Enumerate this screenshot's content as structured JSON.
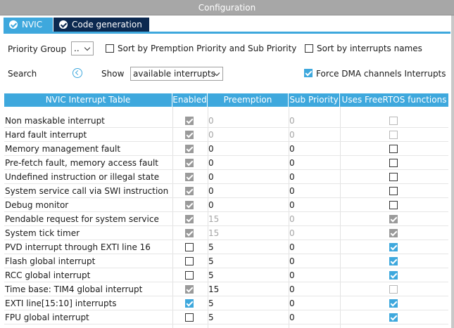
{
  "window": {
    "title": "Configuration"
  },
  "tabs": [
    {
      "label": "NVIC",
      "active": true
    },
    {
      "label": "Code generation",
      "active": false
    }
  ],
  "options": {
    "priority_group_label": "Priority Group",
    "priority_group_value": "..",
    "sort_premption_label": "Sort by Premption Priority and Sub Priority",
    "sort_premption_checked": false,
    "sort_names_label": "Sort by interrupts names",
    "sort_names_checked": false,
    "search_label": "Search",
    "show_label": "Show",
    "show_value": "available interrupts",
    "force_dma_label": "Force DMA channels Interrupts",
    "force_dma_checked": true
  },
  "table": {
    "columns": [
      "NVIC Interrupt Table",
      "Enabled",
      "Preemption Priority",
      "Sub Priority",
      "Uses FreeRTOS functions"
    ],
    "rows": [
      {
        "name": "Non maskable interrupt",
        "enabled": true,
        "enabled_locked": true,
        "preemption": "0",
        "sub": "0",
        "prio_locked": true,
        "freertos": false,
        "freertos_locked": true
      },
      {
        "name": "Hard fault interrupt",
        "enabled": true,
        "enabled_locked": true,
        "preemption": "0",
        "sub": "0",
        "prio_locked": true,
        "freertos": false,
        "freertos_locked": true
      },
      {
        "name": "Memory management fault",
        "enabled": true,
        "enabled_locked": true,
        "preemption": "0",
        "sub": "0",
        "prio_locked": false,
        "freertos": false,
        "freertos_locked": false
      },
      {
        "name": "Pre-fetch fault, memory access fault",
        "enabled": true,
        "enabled_locked": true,
        "preemption": "0",
        "sub": "0",
        "prio_locked": false,
        "freertos": false,
        "freertos_locked": false
      },
      {
        "name": "Undefined instruction or illegal state",
        "enabled": true,
        "enabled_locked": true,
        "preemption": "0",
        "sub": "0",
        "prio_locked": false,
        "freertos": false,
        "freertos_locked": false
      },
      {
        "name": "System service call via SWI instruction",
        "enabled": true,
        "enabled_locked": true,
        "preemption": "0",
        "sub": "0",
        "prio_locked": false,
        "freertos": false,
        "freertos_locked": false
      },
      {
        "name": "Debug monitor",
        "enabled": true,
        "enabled_locked": true,
        "preemption": "0",
        "sub": "0",
        "prio_locked": false,
        "freertos": false,
        "freertos_locked": false
      },
      {
        "name": "Pendable request for system service",
        "enabled": true,
        "enabled_locked": true,
        "preemption": "15",
        "sub": "0",
        "prio_locked": true,
        "freertos": true,
        "freertos_locked": true
      },
      {
        "name": "System tick timer",
        "enabled": true,
        "enabled_locked": true,
        "preemption": "15",
        "sub": "0",
        "prio_locked": true,
        "freertos": true,
        "freertos_locked": true
      },
      {
        "name": "PVD interrupt through EXTI line 16",
        "enabled": false,
        "enabled_locked": false,
        "preemption": "5",
        "sub": "0",
        "prio_locked": false,
        "freertos": true,
        "freertos_locked": false
      },
      {
        "name": "Flash global interrupt",
        "enabled": false,
        "enabled_locked": false,
        "preemption": "5",
        "sub": "0",
        "prio_locked": false,
        "freertos": true,
        "freertos_locked": false
      },
      {
        "name": "RCC global interrupt",
        "enabled": false,
        "enabled_locked": false,
        "preemption": "5",
        "sub": "0",
        "prio_locked": false,
        "freertos": true,
        "freertos_locked": false
      },
      {
        "name": "Time base: TIM4 global interrupt",
        "enabled": true,
        "enabled_locked": true,
        "preemption": "15",
        "sub": "0",
        "prio_locked": false,
        "freertos": false,
        "freertos_locked": true
      },
      {
        "name": "EXTI line[15:10] interrupts",
        "enabled": true,
        "enabled_locked": false,
        "preemption": "5",
        "sub": "0",
        "prio_locked": false,
        "freertos": true,
        "freertos_locked": false
      },
      {
        "name": "FPU global interrupt",
        "enabled": false,
        "enabled_locked": false,
        "preemption": "5",
        "sub": "0",
        "prio_locked": false,
        "freertos": true,
        "freertos_locked": false
      }
    ]
  },
  "colors": {
    "accent": "#3ea8dd",
    "dark_tab": "#0c2950",
    "title_bar": "#a7a7a7"
  }
}
